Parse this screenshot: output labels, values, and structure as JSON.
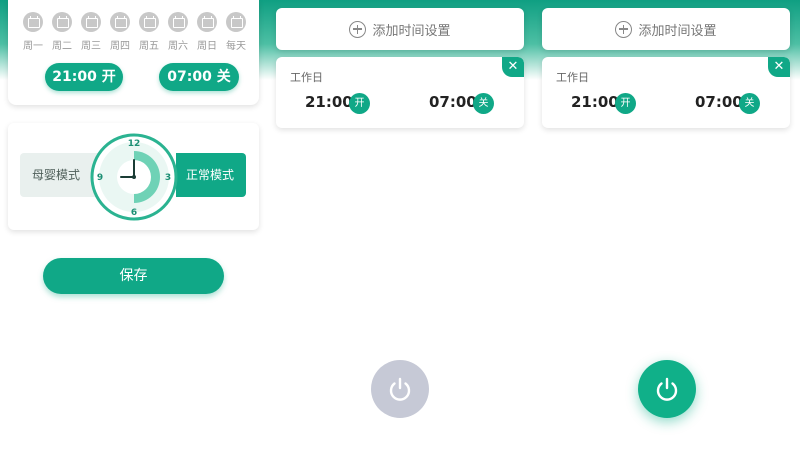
{
  "panel1": {
    "days": [
      {
        "label": "周一"
      },
      {
        "label": "周二"
      },
      {
        "label": "周三"
      },
      {
        "label": "周四"
      },
      {
        "label": "周五"
      },
      {
        "label": "周六"
      },
      {
        "label": "周日"
      },
      {
        "label": "每天"
      }
    ],
    "on_time": "21:00 开",
    "off_time": "07:00 关",
    "mode_left": "母婴模式",
    "mode_right": "正常模式",
    "clock_numbers": {
      "top": "12",
      "right": "3",
      "bottom": "6",
      "left": "9"
    },
    "save_label": "保存"
  },
  "panel2": {
    "add_label": "添加时间设置",
    "schedule": {
      "title": "工作日",
      "on_time": "21:00",
      "on_badge": "开",
      "off_time": "07:00",
      "off_badge": "关",
      "close": "✕"
    }
  },
  "panel3": {
    "add_label": "添加时间设置",
    "schedule": {
      "title": "工作日",
      "on_time": "21:00",
      "on_badge": "开",
      "off_time": "07:00",
      "off_badge": "关",
      "close": "✕"
    }
  },
  "colors": {
    "accent": "#10a887",
    "power_off": "#c6c9d6",
    "day_icon": "#c8c8c8"
  },
  "icons": {
    "day": "calendar-icon",
    "add": "plus-circle-icon",
    "power": "power-icon",
    "close": "close-icon"
  },
  "power_states": {
    "panel2": "off",
    "panel3": "on"
  }
}
